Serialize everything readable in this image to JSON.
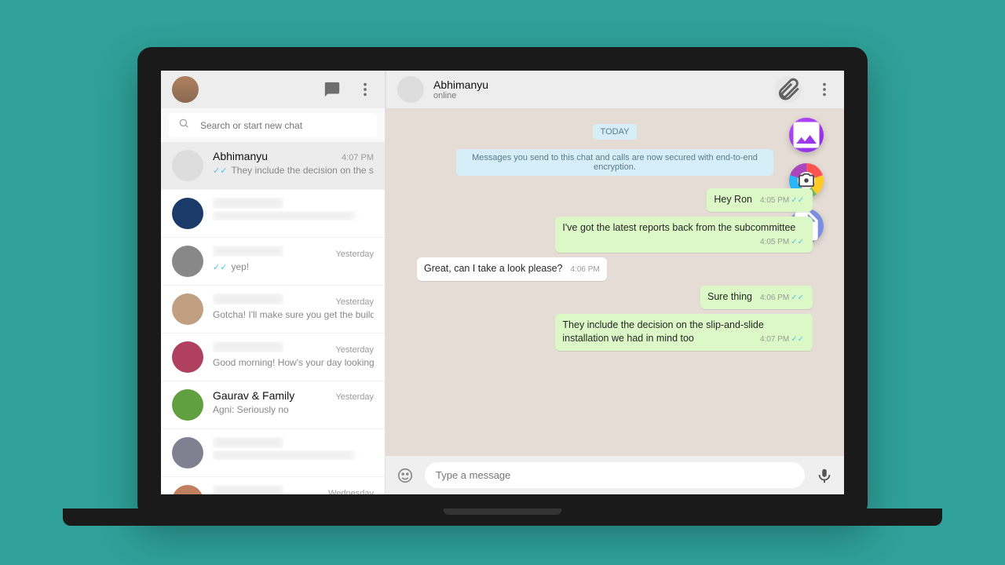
{
  "sidebar": {
    "search_placeholder": "Search or start new chat",
    "chats": [
      {
        "name": "Abhimanyu",
        "time": "4:07 PM",
        "preview": "They include the decision on the slip-and-...",
        "read": true,
        "active": true,
        "blurred": false
      },
      {
        "name": "",
        "time": "",
        "preview": "",
        "blurred": true
      },
      {
        "name": "",
        "time": "Yesterday",
        "preview": "yep!",
        "read": true,
        "blurred_name": true
      },
      {
        "name": "",
        "time": "Yesterday",
        "preview": "Gotcha! I'll make sure you get the build to tes...",
        "blurred_name": true
      },
      {
        "name": "",
        "time": "Yesterday",
        "preview": "Good morning! How's your day looking?",
        "blurred_name": true
      },
      {
        "name": "Gaurav & Family",
        "time": "Yesterday",
        "preview": "Agni: Seriously no"
      },
      {
        "name": "",
        "time": "",
        "preview": "",
        "blurred": true
      },
      {
        "name": "",
        "time": "Wednesday",
        "preview": "",
        "blurred_name": true
      }
    ]
  },
  "conversation": {
    "contact_name": "Abhimanyu",
    "contact_status": "online",
    "date_label": "TODAY",
    "encryption_notice": "Messages you send to this chat and calls are now secured with end-to-end encryption.",
    "messages": [
      {
        "dir": "out",
        "text": "Hey Ron",
        "time": "4:05 PM",
        "read": true
      },
      {
        "dir": "out",
        "text": "I've got the latest reports back from the subcommittee",
        "time": "4:05 PM",
        "read": true
      },
      {
        "dir": "in",
        "text": "Great, can I take a look please?",
        "time": "4:06 PM"
      },
      {
        "dir": "out",
        "text": "Sure thing",
        "time": "4:06 PM",
        "read": true
      },
      {
        "dir": "out",
        "text": "They include the decision on the slip-and-slide installation we had in mind too",
        "time": "4:07 PM",
        "read": true
      }
    ],
    "composer_placeholder": "Type a message"
  },
  "attach_menu": {
    "tooltip": "Document"
  }
}
